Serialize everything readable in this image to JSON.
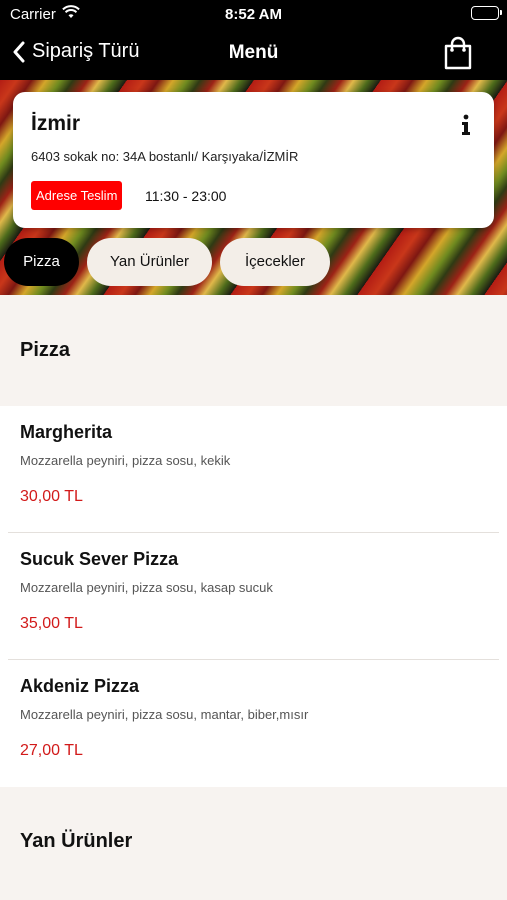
{
  "status_bar": {
    "carrier": "Carrier",
    "time": "8:52 AM"
  },
  "nav": {
    "back_label": "Sipariş Türü",
    "title": "Menü"
  },
  "store": {
    "city": "İzmir",
    "address": "6403 sokak no: 34A bostanlı/ Karşıyaka/İZMİR",
    "delivery_badge": "Adrese Teslim",
    "hours": "11:30 - 23:00"
  },
  "tabs": [
    {
      "label": "Pizza",
      "active": true
    },
    {
      "label": "Yan Ürünler",
      "active": false
    },
    {
      "label": "İçecekler",
      "active": false
    }
  ],
  "sections": [
    {
      "title": "Pizza",
      "items": [
        {
          "name": "Margherita",
          "description": "Mozzarella peyniri, pizza sosu, kekik",
          "price": "30,00 TL"
        },
        {
          "name": "Sucuk Sever Pizza",
          "description": "Mozzarella peyniri, pizza sosu, kasap sucuk",
          "price": "35,00 TL"
        },
        {
          "name": "Akdeniz Pizza",
          "description": "Mozzarella peyniri, pizza sosu, mantar, biber,mısır",
          "price": "27,00 TL"
        }
      ]
    },
    {
      "title": "Yan Ürünler",
      "items": []
    }
  ],
  "colors": {
    "price": "#d21a1a",
    "badge": "#ff0000",
    "nav_background": "#000000",
    "page_background": "#f7f3f0"
  },
  "icons": {
    "back": "chevron-left-icon",
    "cart": "shopping-bag-icon",
    "info": "info-icon",
    "wifi": "wifi-icon",
    "battery": "battery-icon"
  }
}
